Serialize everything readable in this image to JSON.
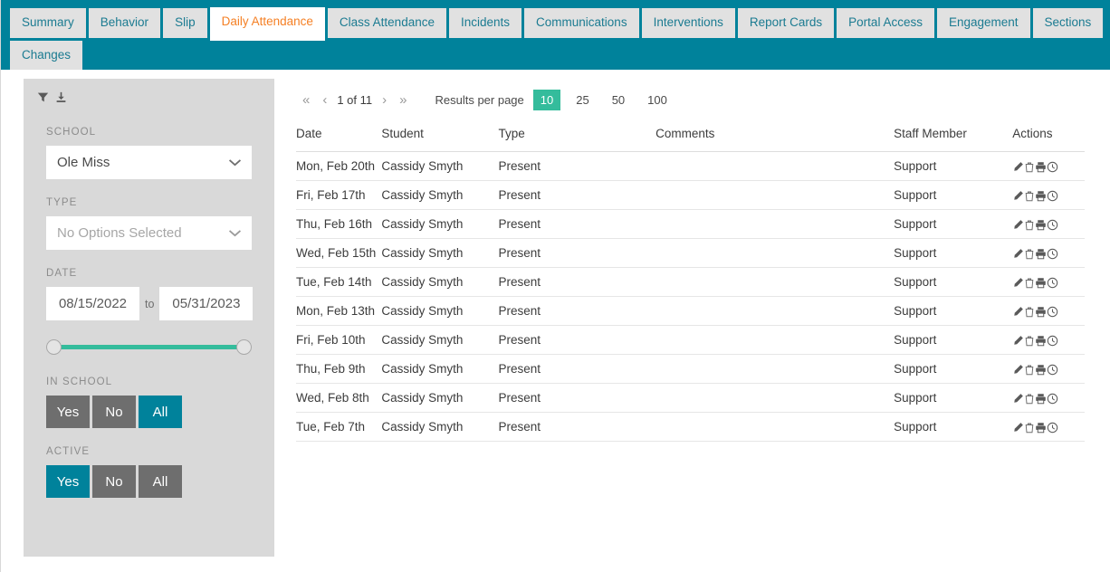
{
  "tabs": {
    "row1": [
      {
        "label": "Summary",
        "active": false
      },
      {
        "label": "Behavior",
        "active": false
      },
      {
        "label": "Slip",
        "active": false
      },
      {
        "label": "Daily Attendance",
        "active": true
      },
      {
        "label": "Class Attendance",
        "active": false
      },
      {
        "label": "Incidents",
        "active": false
      },
      {
        "label": "Communications",
        "active": false
      },
      {
        "label": "Interventions",
        "active": false
      },
      {
        "label": "Report Cards",
        "active": false
      },
      {
        "label": "Portal Access",
        "active": false
      },
      {
        "label": "Engagement",
        "active": false
      },
      {
        "label": "Sections",
        "active": false
      }
    ],
    "row2": [
      {
        "label": "Changes",
        "active": false
      }
    ]
  },
  "sidebar": {
    "icons": [
      {
        "name": "filter-icon"
      },
      {
        "name": "download-icon"
      }
    ],
    "school": {
      "label": "SCHOOL",
      "value": "Ole Miss"
    },
    "type": {
      "label": "TYPE",
      "value": "No Options Selected"
    },
    "date": {
      "label": "DATE",
      "from": "08/15/2022",
      "to_label": "to",
      "to": "05/31/2023"
    },
    "in_school": {
      "label": "IN SCHOOL",
      "options": [
        "Yes",
        "No",
        "All"
      ],
      "selected": "All"
    },
    "active": {
      "label": "ACTIVE",
      "options": [
        "Yes",
        "No",
        "All"
      ],
      "selected": "Yes"
    }
  },
  "pagination": {
    "first": "«",
    "prev": "‹",
    "page_text": "1 of 11",
    "next": "›",
    "last": "»",
    "results_per_page_label": "Results per page",
    "page_sizes": [
      "10",
      "25",
      "50",
      "100"
    ],
    "selected_page_size": "10"
  },
  "table": {
    "columns": [
      "Date",
      "Student",
      "Type",
      "Comments",
      "Staff Member",
      "Actions"
    ],
    "action_icons": [
      "edit-icon",
      "delete-icon",
      "print-icon",
      "history-icon"
    ],
    "rows": [
      {
        "date": "Mon, Feb 20th",
        "student": "Cassidy Smyth",
        "type": "Present",
        "comments": "",
        "staff": "Support"
      },
      {
        "date": "Fri, Feb 17th",
        "student": "Cassidy Smyth",
        "type": "Present",
        "comments": "",
        "staff": "Support"
      },
      {
        "date": "Thu, Feb 16th",
        "student": "Cassidy Smyth",
        "type": "Present",
        "comments": "",
        "staff": "Support"
      },
      {
        "date": "Wed, Feb 15th",
        "student": "Cassidy Smyth",
        "type": "Present",
        "comments": "",
        "staff": "Support"
      },
      {
        "date": "Tue, Feb 14th",
        "student": "Cassidy Smyth",
        "type": "Present",
        "comments": "",
        "staff": "Support"
      },
      {
        "date": "Mon, Feb 13th",
        "student": "Cassidy Smyth",
        "type": "Present",
        "comments": "",
        "staff": "Support"
      },
      {
        "date": "Fri, Feb 10th",
        "student": "Cassidy Smyth",
        "type": "Present",
        "comments": "",
        "staff": "Support"
      },
      {
        "date": "Thu, Feb 9th",
        "student": "Cassidy Smyth",
        "type": "Present",
        "comments": "",
        "staff": "Support"
      },
      {
        "date": "Wed, Feb 8th",
        "student": "Cassidy Smyth",
        "type": "Present",
        "comments": "",
        "staff": "Support"
      },
      {
        "date": "Tue, Feb 7th",
        "student": "Cassidy Smyth",
        "type": "Present",
        "comments": "",
        "staff": "Support"
      }
    ]
  },
  "colors": {
    "tab_bar_teal": "#00829B",
    "accent_orange": "#F79646",
    "active_tab_text": "#F58025",
    "green_teal": "#34BC9C",
    "sidebar_gray": "#d9d9d9",
    "toggle_gray": "#6e6e6e"
  }
}
